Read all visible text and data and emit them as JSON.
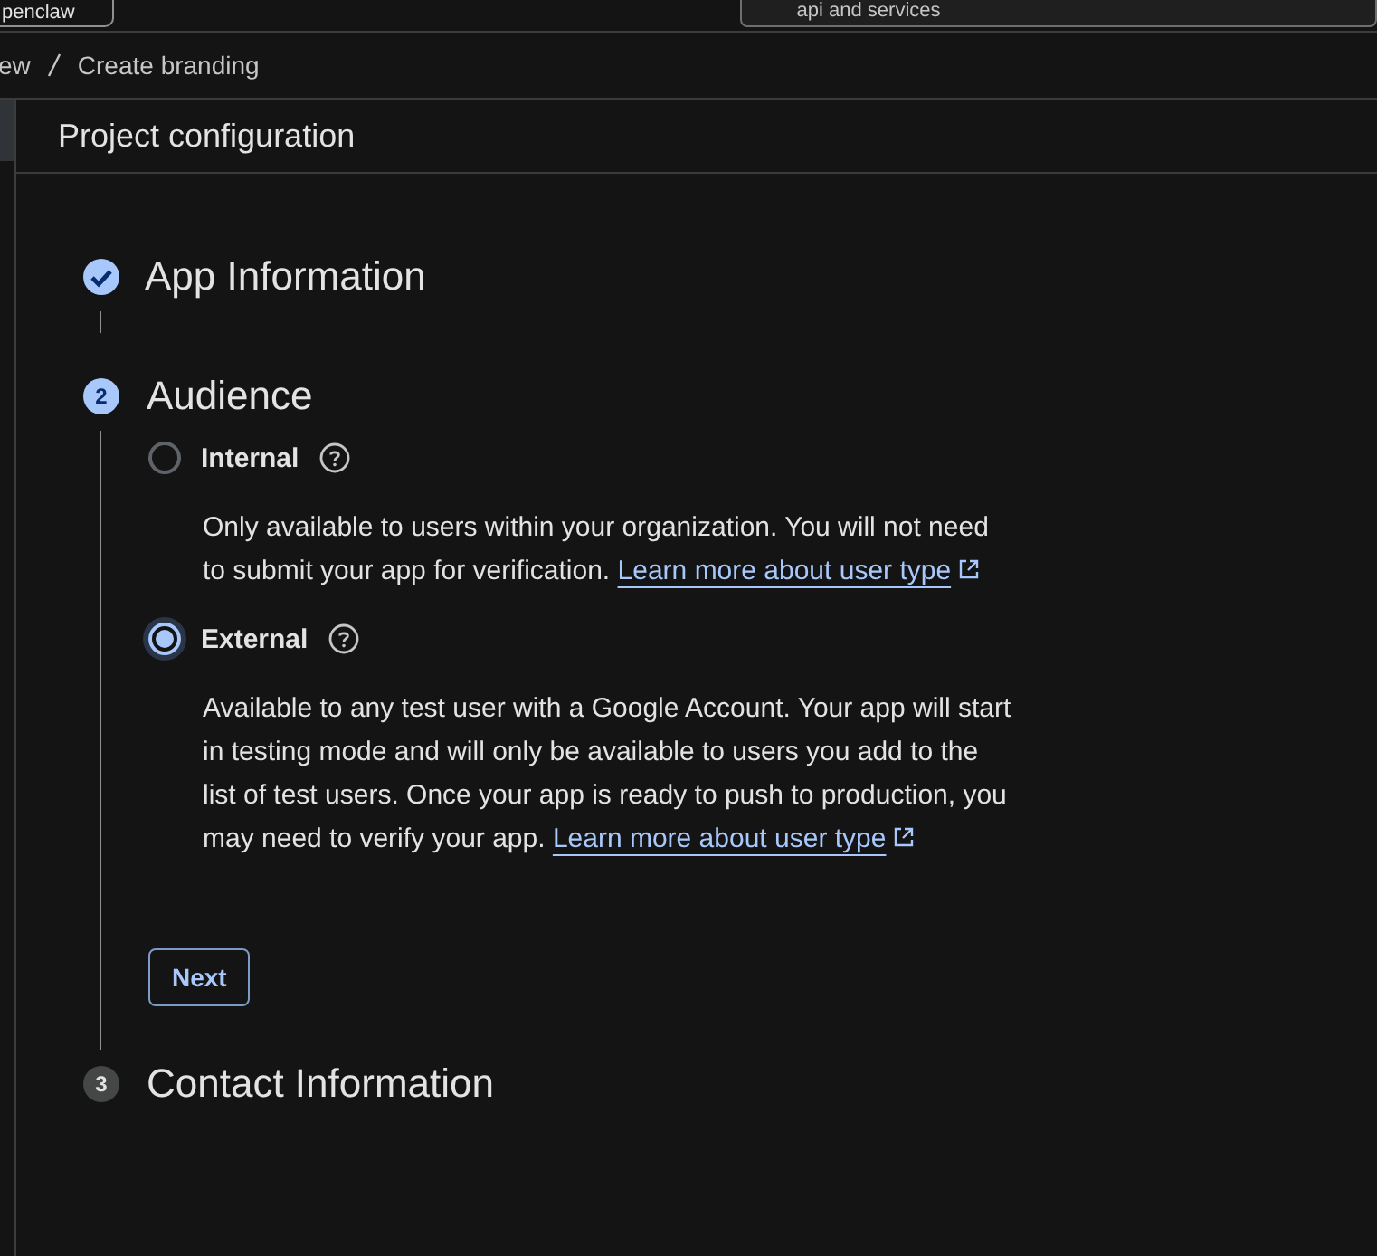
{
  "top_bar": {
    "button": "penclaw",
    "search": {
      "value": "api and services"
    }
  },
  "breadcrumb": [
    "ew",
    "Create branding"
  ],
  "header": {
    "title": "Project configuration"
  },
  "steps": [
    {
      "kind": "done",
      "title": "App Information"
    },
    {
      "kind": "current",
      "number": "2",
      "title": "Audience",
      "options": [
        {
          "label": "Internal",
          "selected": false,
          "description": "Only available to users within your organization. You will not need to submit your app for verification.",
          "link": "Learn more about user type"
        },
        {
          "label": "External",
          "selected": true,
          "description": "Available to any test user with a Google Account. Your app will start in testing mode and will only be available to users you add to the list of test users. Once your app is ready to push to production, you may need to verify your app.",
          "link": "Learn more about user type"
        }
      ],
      "button": "Next"
    },
    {
      "kind": "pending",
      "number": "3",
      "title": "Contact Information"
    }
  ]
}
